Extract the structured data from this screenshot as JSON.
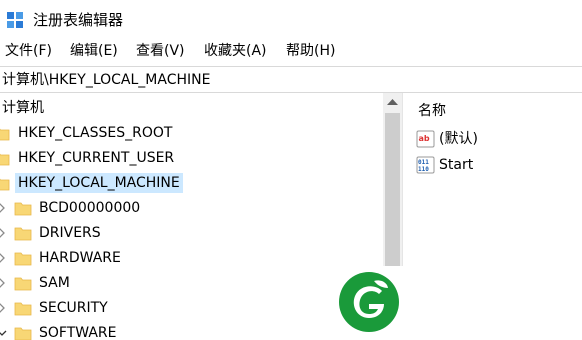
{
  "window": {
    "title": "注册表编辑器",
    "app_icon": "registry-editor-icon"
  },
  "menu": [
    {
      "label": "文件(F)"
    },
    {
      "label": "编辑(E)"
    },
    {
      "label": "查看(V)"
    },
    {
      "label": "收藏夹(A)"
    },
    {
      "label": "帮助(H)"
    }
  ],
  "address": {
    "path": "计算机\\HKEY_LOCAL_MACHINE"
  },
  "tree": {
    "root": "计算机",
    "hives": [
      {
        "label": "HKEY_CLASSES_ROOT"
      },
      {
        "label": "HKEY_CURRENT_USER"
      },
      {
        "label": "HKEY_LOCAL_MACHINE",
        "selected": true
      }
    ],
    "children": [
      {
        "label": "BCD00000000"
      },
      {
        "label": "DRIVERS"
      },
      {
        "label": "HARDWARE"
      },
      {
        "label": "SAM"
      },
      {
        "label": "SECURITY"
      },
      {
        "label": "SOFTWARE",
        "expanded": true
      }
    ]
  },
  "values": {
    "column_name": "名称",
    "items": [
      {
        "name": "(默认)",
        "icon": "string-value-icon"
      },
      {
        "name": "Start",
        "icon": "binary-value-icon"
      }
    ]
  },
  "colors": {
    "selection": "#cce8ff",
    "folder": "#f8d775",
    "folder_dark": "#e8b84a",
    "logo_green": "#1a9a3a",
    "scroll_thumb": "#cdcdcd"
  }
}
